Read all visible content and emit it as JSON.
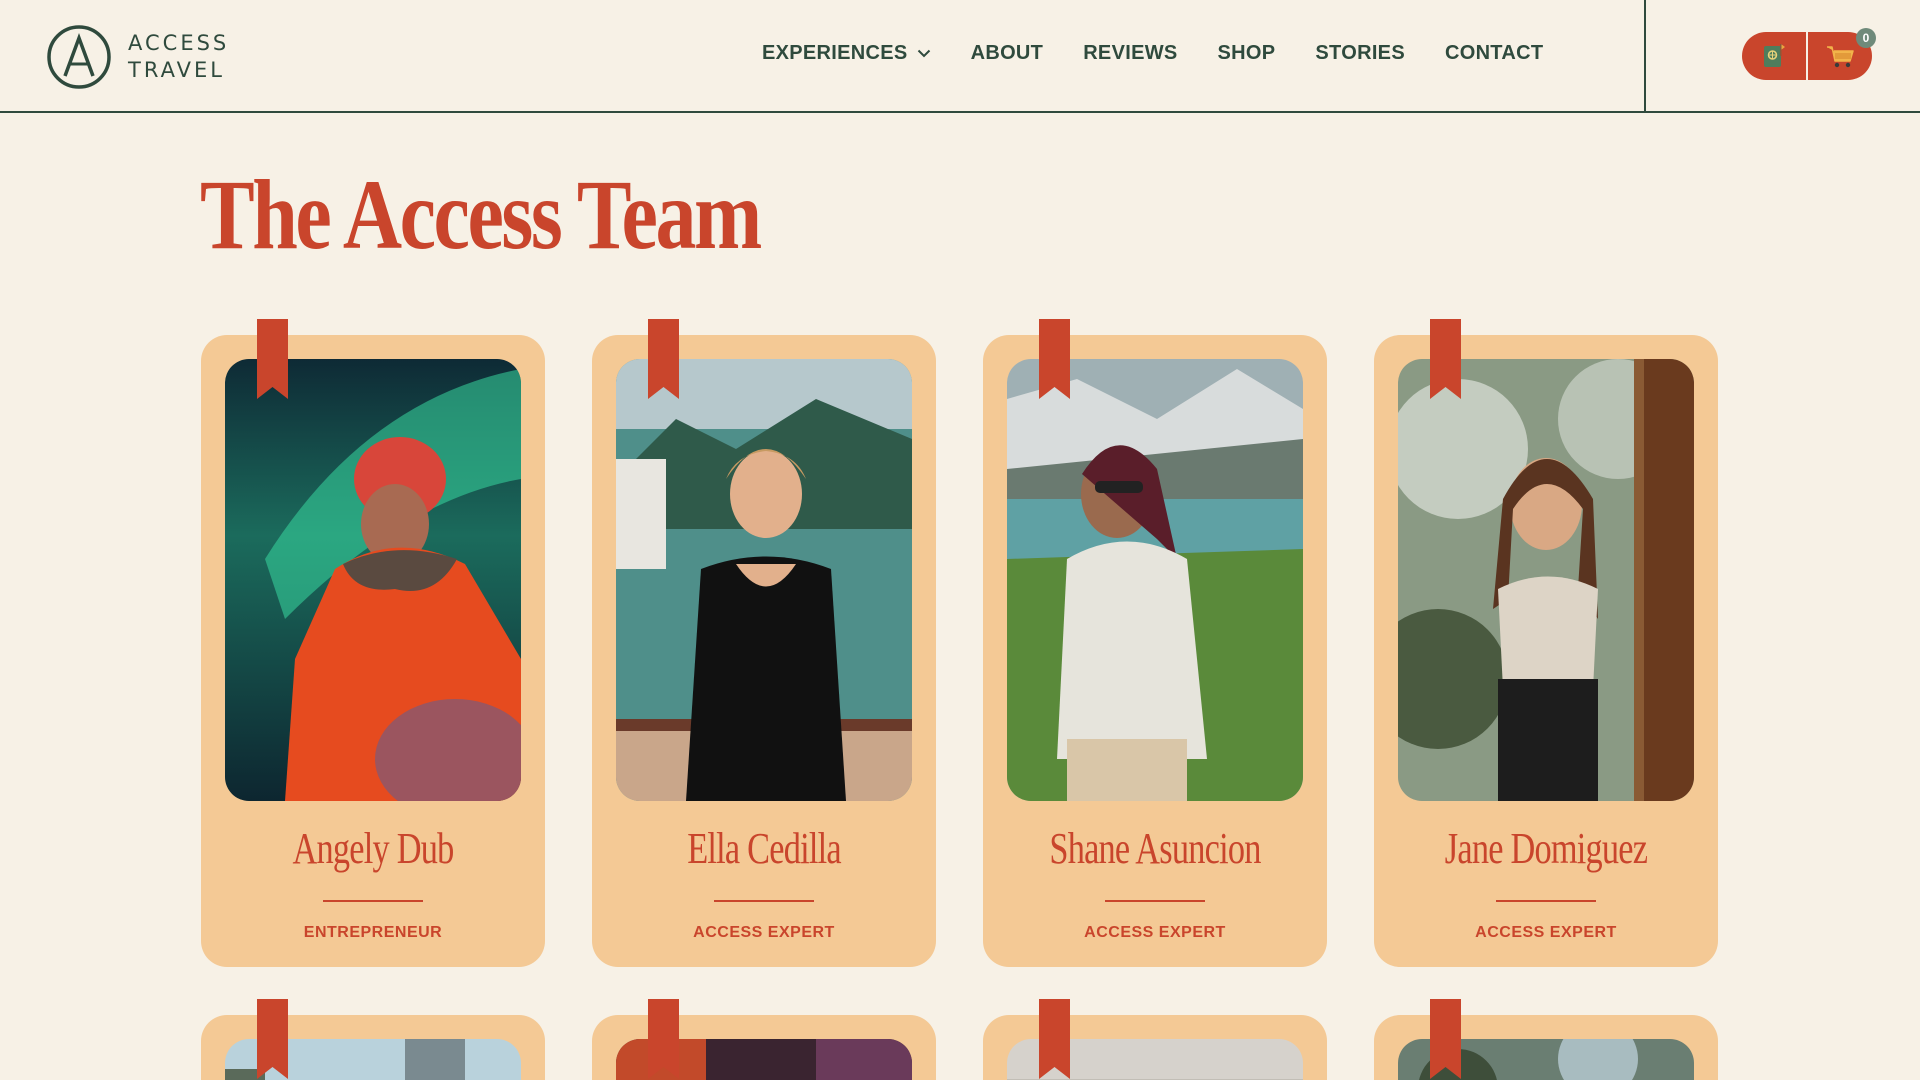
{
  "brand": {
    "line1": "ACCESS",
    "line2": "TRAVEL",
    "logo_icon": "compass-a-logo",
    "accent": "#c9452c",
    "dark": "#2f4a3d",
    "background": "#f7f1e6",
    "card": "#f4c995"
  },
  "nav": {
    "items": [
      {
        "label": "EXPERIENCES",
        "has_dropdown": true
      },
      {
        "label": "ABOUT"
      },
      {
        "label": "REVIEWS"
      },
      {
        "label": "SHOP"
      },
      {
        "label": "STORIES"
      },
      {
        "label": "CONTACT"
      }
    ],
    "passport_icon": "passport-icon",
    "cart_icon": "cart-icon",
    "cart_count": "0"
  },
  "page": {
    "title": "The Access Team"
  },
  "team": [
    {
      "name": "Angely Dub",
      "role": "ENTREPRENEUR"
    },
    {
      "name": "Ella Cedilla",
      "role": "ACCESS EXPERT"
    },
    {
      "name": "Shane Asuncion",
      "role": "ACCESS EXPERT"
    },
    {
      "name": "Jane Domiguez",
      "role": "ACCESS EXPERT"
    }
  ]
}
